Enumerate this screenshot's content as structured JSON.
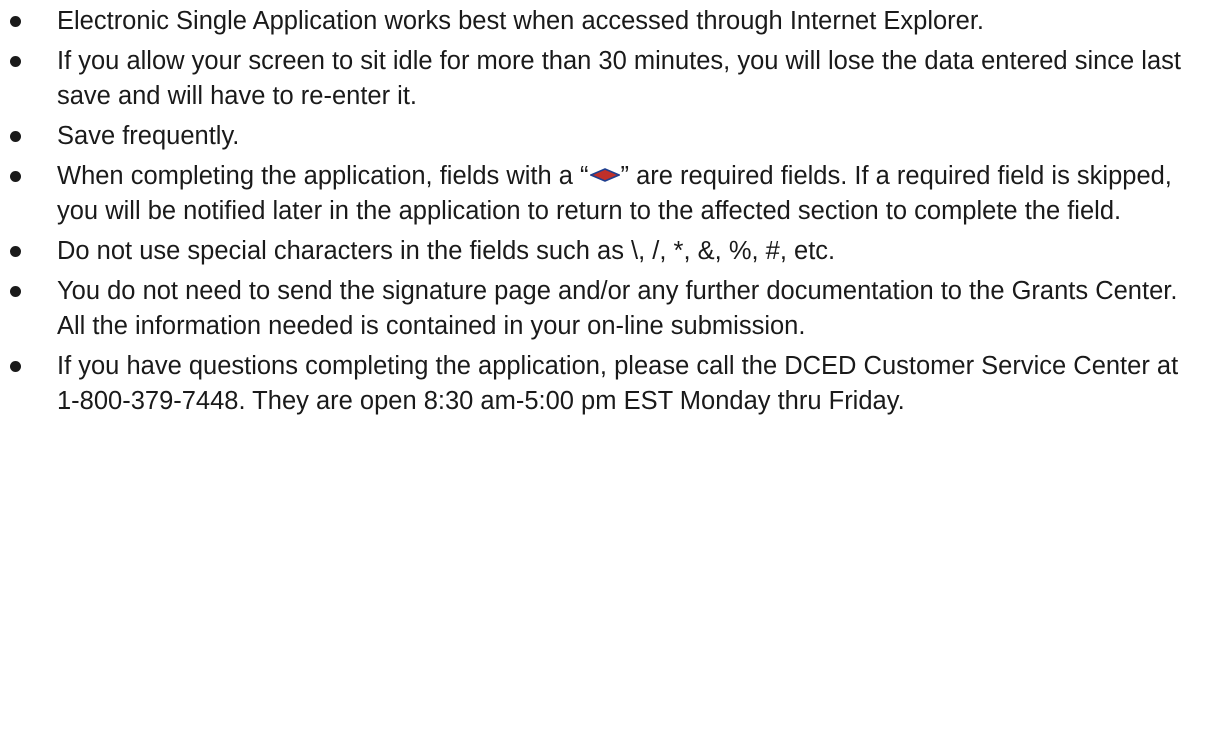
{
  "items": [
    {
      "text": "Electronic Single Application works best when accessed through Internet Explorer."
    },
    {
      "text": "If you allow your screen to sit idle for more than 30 minutes, you will lose the data entered since last save and will have to re-enter it."
    },
    {
      "text": "Save frequently."
    },
    {
      "text_before": "When completing the application, fields with a “",
      "icon": "required-field-diamond-icon",
      "text_after": "” are required fields.  If a required field is skipped, you will be notified later in the application to return to the affected section to complete the field."
    },
    {
      "text": "Do not use special characters in the fields such as \\, /, *, &, %, #, etc."
    },
    {
      "text": "You do not need to send the signature page and/or any further documentation to the Grants Center.  All the information needed is contained in your on-line submission."
    },
    {
      "text": "If you have questions completing the application, please call the DCED Customer Service Center at 1-800-379-7448.  They are open 8:30 am-5:00 pm EST Monday thru Friday."
    }
  ],
  "colors": {
    "text": "#1a1a1a",
    "required_icon_fill": "#c0302a",
    "required_icon_stroke": "#1f3f8f"
  }
}
